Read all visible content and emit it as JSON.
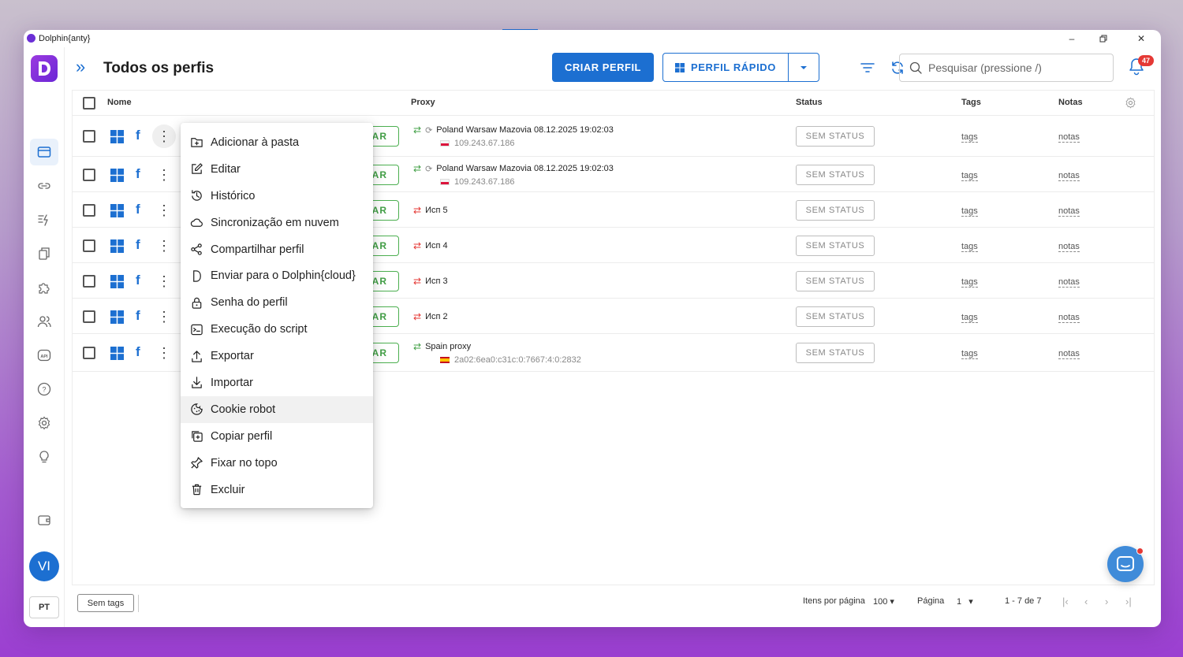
{
  "window": {
    "title": "Dolphin{anty}"
  },
  "sidebar": {
    "avatar_initials": "VI",
    "language": "PT",
    "items": [
      {
        "name": "profiles",
        "icon": "browser-window-icon"
      },
      {
        "name": "proxies",
        "icon": "link-icon"
      },
      {
        "name": "automation",
        "icon": "bolt-list-icon"
      },
      {
        "name": "templates",
        "icon": "copy-icon"
      },
      {
        "name": "extensions",
        "icon": "puzzle-icon"
      },
      {
        "name": "users",
        "icon": "users-icon"
      },
      {
        "name": "api",
        "icon": "api-icon"
      },
      {
        "name": "help",
        "icon": "help-icon"
      },
      {
        "name": "settings",
        "icon": "gear-icon"
      },
      {
        "name": "ideas",
        "icon": "lightbulb-icon"
      },
      {
        "name": "wallet",
        "icon": "wallet-icon"
      }
    ]
  },
  "toolbar": {
    "title": "Todos os perfis",
    "create_label": "CRIAR PERFIL",
    "quick_label": "PERFIL RÁPIDO",
    "search_placeholder": "Pesquisar (pressione /)",
    "notifications_count": "47"
  },
  "table": {
    "headers": {
      "name": "Nome",
      "proxy": "Proxy",
      "status": "Status",
      "tags": "Tags",
      "notes": "Notas"
    },
    "start_label": "AR",
    "status_label": "SEM STATUS",
    "tags_label": "tags",
    "notes_label": "notas",
    "rows": [
      {
        "proxy_name": "Poland Warsaw Mazovia 08.12.2025 19:02:03",
        "proxy_ip": "109.243.67.186"
      },
      {
        "proxy_name": "Poland Warsaw Mazovia 08.12.2025 19:02:03",
        "proxy_ip": "109.243.67.186"
      },
      {
        "proxy_name": "Исп 5",
        "proxy_ip": ""
      },
      {
        "proxy_name": "Исп 4",
        "proxy_ip": ""
      },
      {
        "proxy_name": "Исп 3",
        "proxy_ip": ""
      },
      {
        "proxy_name": "Исп 2",
        "proxy_ip": ""
      },
      {
        "proxy_name": "Spain proxy",
        "proxy_ip": "2a02:6ea0:c31c:0:7667:4:0:2832"
      }
    ]
  },
  "context_menu": {
    "items": [
      {
        "label": "Adicionar à pasta",
        "icon": "folder-plus-icon"
      },
      {
        "label": "Editar",
        "icon": "edit-icon"
      },
      {
        "label": "Histórico",
        "icon": "history-icon"
      },
      {
        "label": "Sincronização em nuvem",
        "icon": "cloud-icon"
      },
      {
        "label": "Compartilhar perfil",
        "icon": "share-icon"
      },
      {
        "label": "Enviar para o Dolphin{cloud}",
        "icon": "dolphin-cloud-icon"
      },
      {
        "label": "Senha do perfil",
        "icon": "lock-icon"
      },
      {
        "label": "Execução do script",
        "icon": "terminal-icon"
      },
      {
        "label": "Exportar",
        "icon": "export-icon"
      },
      {
        "label": "Importar",
        "icon": "import-icon"
      },
      {
        "label": "Cookie robot",
        "icon": "cookie-icon"
      },
      {
        "label": "Copiar perfil",
        "icon": "copy-icon"
      },
      {
        "label": "Fixar no topo",
        "icon": "pin-icon"
      },
      {
        "label": "Excluir",
        "icon": "trash-icon"
      }
    ]
  },
  "footer": {
    "no_tags_label": "Sem tags",
    "items_per_page_label": "Itens por página",
    "items_per_page_value": "100",
    "page_label": "Página",
    "page_value": "1",
    "range_label": "1 - 7 de 7"
  },
  "colors": {
    "accent": "#1c6fd1",
    "start_green": "#43a047",
    "danger": "#e53935",
    "brand": "#6b27d6"
  }
}
